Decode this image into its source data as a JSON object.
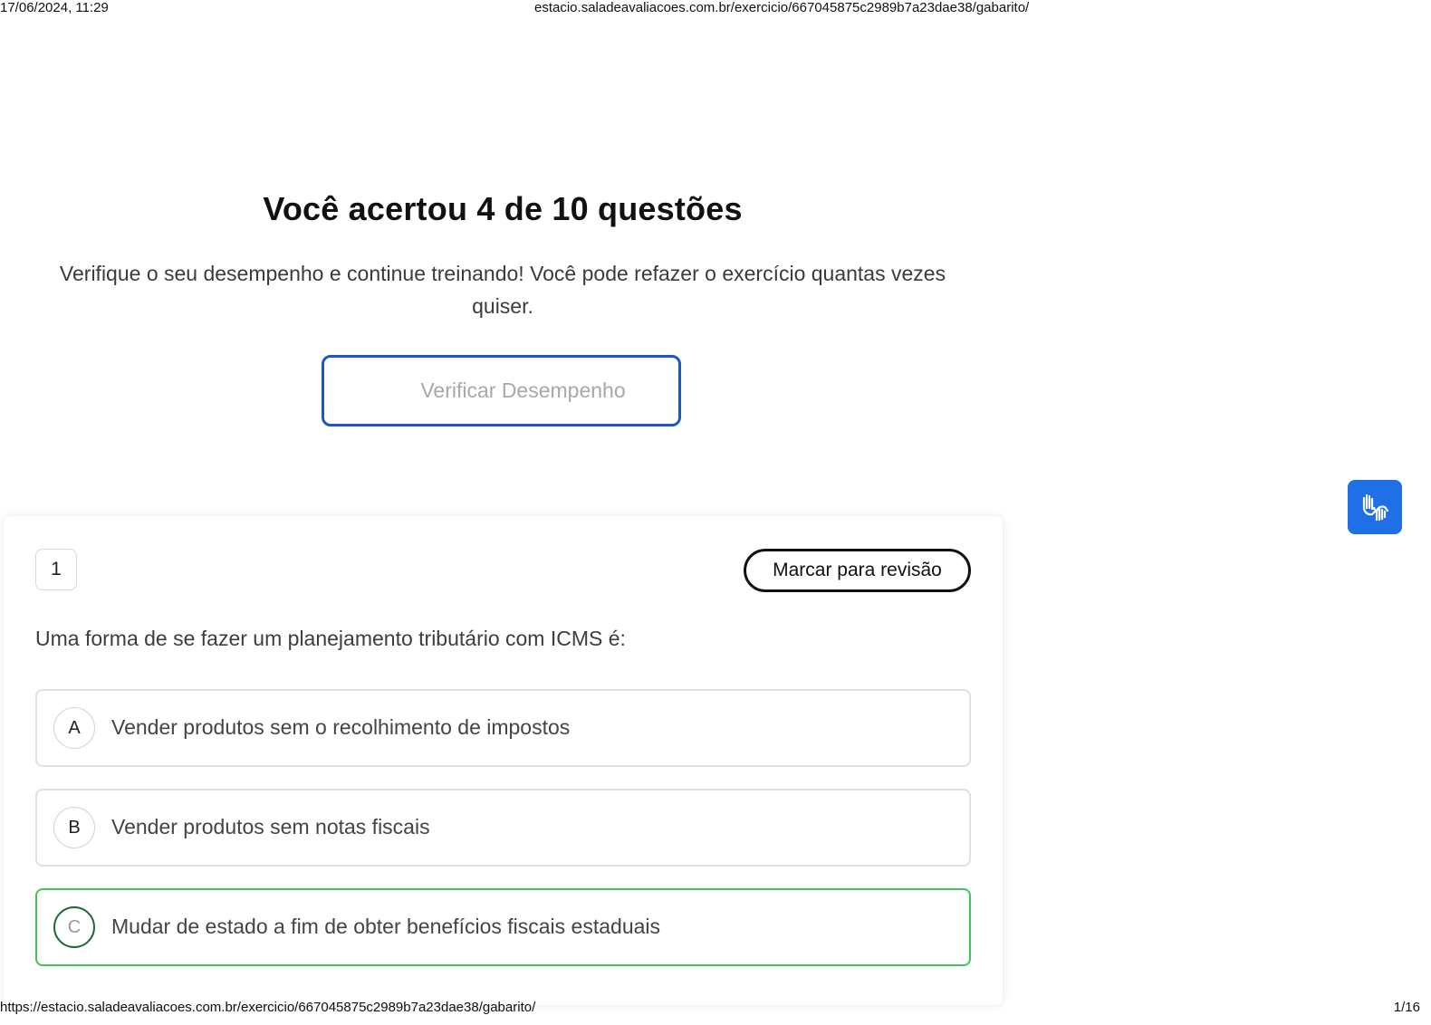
{
  "print_header": {
    "datetime": "17/06/2024, 11:29",
    "page_url": "estacio.saladeavaliacoes.com.br/exercicio/667045875c2989b7a23dae38/gabarito/"
  },
  "result": {
    "title": "Você acertou 4 de 10 questões",
    "subtitle": "Verifique o seu desempenho e continue treinando! Você pode refazer o exercício quantas vezes quiser.",
    "verify_button_label": "Verificar Desempenho"
  },
  "accessibility_widget": {
    "icon": "sign-language-hands-icon",
    "color": "#1f6fe6"
  },
  "question": {
    "number": "1",
    "review_button_label": "Marcar para revisão",
    "text": "Uma forma de se fazer um planejamento tributário com ICMS é:",
    "options": [
      {
        "letter": "A",
        "text": "Vender produtos sem o recolhimento de impostos",
        "status": "neutral"
      },
      {
        "letter": "B",
        "text": "Vender produtos sem notas fiscais",
        "status": "neutral"
      },
      {
        "letter": "C",
        "text": "Mudar de estado a fim de obter benefícios fiscais estaduais",
        "status": "correct"
      }
    ]
  },
  "colors": {
    "accent_blue": "#1e56c8",
    "correct_green": "#41c45e"
  },
  "print_footer": {
    "url": "https://estacio.saladeavaliacoes.com.br/exercicio/667045875c2989b7a23dae38/gabarito/",
    "page_indicator": "1/16"
  }
}
